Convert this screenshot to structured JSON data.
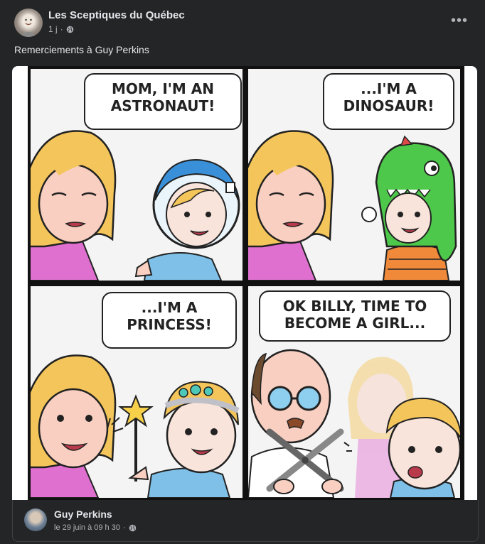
{
  "post": {
    "page_name": "Les Sceptiques du Québec",
    "time": "1 j",
    "separator": "·",
    "caption": "Remerciements à Guy Perkins",
    "more_label": "•••"
  },
  "comic": {
    "panels": [
      {
        "bubble": "MOM, I'M AN ASTRONAUT!"
      },
      {
        "bubble": "...I'M A DINOSAUR!"
      },
      {
        "bubble": "...I'M A PRINCESS!"
      },
      {
        "bubble": "OK BILLY, TIME TO BECOME A GIRL..."
      }
    ]
  },
  "shared_from": {
    "name": "Guy Perkins",
    "date": "le 29 juin à 09 h 30",
    "separator": "·"
  },
  "colors": {
    "background": "#242526",
    "text_primary": "#e4e6eb",
    "text_secondary": "#b0b3b8"
  },
  "icons": [
    "globe-icon",
    "more-options-icon"
  ]
}
